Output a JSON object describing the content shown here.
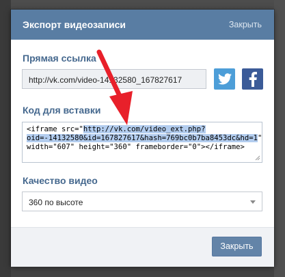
{
  "dialog": {
    "title": "Экспорт видеозаписи",
    "close_link": "Закрыть"
  },
  "direct_link": {
    "label": "Прямая ссылка",
    "value": "http://vk.com/video-14132580_167827617",
    "share": [
      {
        "name": "twitter",
        "icon": "twitter-icon",
        "color": "#4d9ed8"
      },
      {
        "name": "facebook",
        "icon": "facebook-icon",
        "color": "#3b5b98"
      }
    ]
  },
  "embed": {
    "label": "Код для вставки",
    "line1_plain": "<iframe src=\"",
    "line1_hl": "http://vk.com/video_ext.php?",
    "line2_hl": "oid=-14132580&id=167827617&hash=769bc0b7ba8453dc&hd=1",
    "line2_plain": "\"",
    "line3": "width=\"607\" height=\"360\" frameborder=\"0\"></iframe>"
  },
  "quality": {
    "label": "Качество видео",
    "selected": "360 по высоте"
  },
  "footer": {
    "close_button": "Закрыть"
  },
  "colors": {
    "header": "#597da3",
    "label": "#45688e",
    "button": "#6384a8",
    "annotation_arrow": "#e8202a"
  }
}
